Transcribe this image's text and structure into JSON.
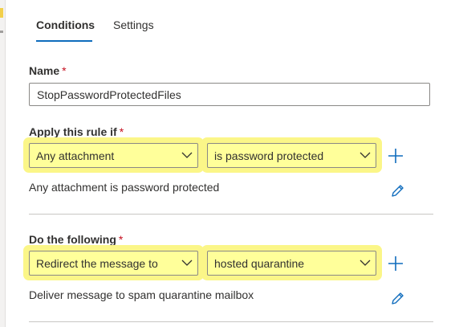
{
  "tabs": {
    "conditions": "Conditions",
    "settings": "Settings"
  },
  "name_section": {
    "label": "Name",
    "required_mark": "*",
    "value": "StopPasswordProtectedFiles"
  },
  "apply_section": {
    "label": "Apply this rule if",
    "required_mark": "*",
    "condition_dropdown": "Any attachment",
    "operator_dropdown": "is password protected",
    "summary": "Any attachment is password protected"
  },
  "action_section": {
    "label": "Do the following",
    "required_mark": "*",
    "action_dropdown": "Redirect the message to",
    "target_dropdown": "hosted quarantine",
    "summary": "Deliver message to spam quarantine mailbox"
  },
  "icons": {
    "add": "plus-icon",
    "edit": "pencil-icon",
    "expand": "chevron-down-icon"
  },
  "colors": {
    "accent": "#0f6cbd",
    "required": "#c50f1f",
    "highlight": "#fbf688"
  }
}
